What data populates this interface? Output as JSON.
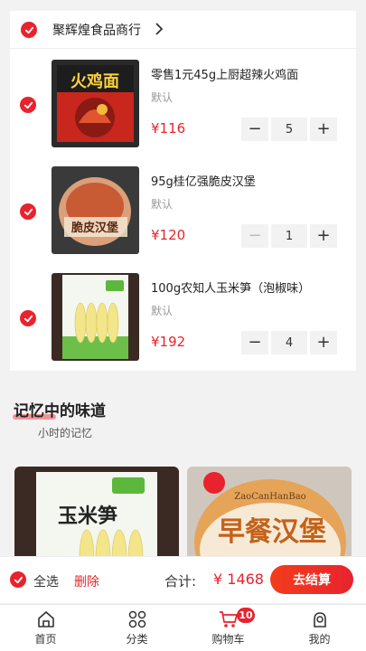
{
  "shop": {
    "name": "聚辉煌食品商行"
  },
  "items": [
    {
      "title": "零售1元45g上厨超辣火鸡面",
      "spec": "默认",
      "price": "¥116",
      "qty": "5"
    },
    {
      "title": "95g桂亿强脆皮汉堡",
      "spec": "默认",
      "price": "¥120",
      "qty": "1"
    },
    {
      "title": "100g农知人玉米笋（泡椒味）",
      "spec": "默认",
      "price": "¥192",
      "qty": "4"
    }
  ],
  "stepper": {
    "minus": "−",
    "plus": "+"
  },
  "recommend": {
    "title": "记忆中的味道",
    "subtitle": "小时的记忆"
  },
  "product_art": {
    "noodle_text": "火鸡面",
    "burger_text": "脆皮汉堡",
    "corn_text": "玉米笋",
    "burger_big_text": "早餐汉堡",
    "burger_pinyin": "ZaoCanHanBao"
  },
  "checkout": {
    "select_all": "全选",
    "delete": "删除",
    "total_label": "合计:",
    "total_value": "¥ 1468",
    "button": "去结算"
  },
  "tabs": [
    {
      "label": "首页",
      "icon": "home-icon"
    },
    {
      "label": "分类",
      "icon": "grid-icon"
    },
    {
      "label": "购物车",
      "icon": "cart-icon"
    },
    {
      "label": "我的",
      "icon": "user-icon"
    }
  ],
  "cart_badge": "10",
  "colors": {
    "accent": "#e8232d",
    "background": "#f2f2f2"
  }
}
